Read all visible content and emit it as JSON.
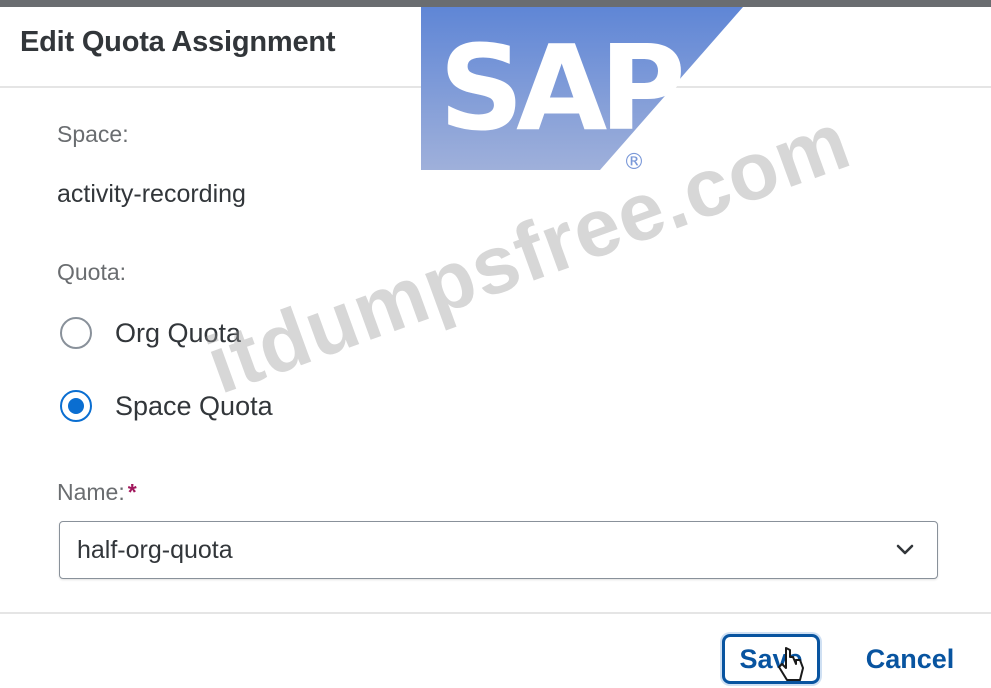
{
  "dialog": {
    "title": "Edit Quota Assignment"
  },
  "space": {
    "label": "Space:",
    "value": "activity-recording"
  },
  "quota": {
    "label": "Quota:",
    "options": [
      {
        "label": "Org Quota",
        "selected": false
      },
      {
        "label": "Space Quota",
        "selected": true
      }
    ]
  },
  "name_field": {
    "label": "Name:",
    "required_marker": "*",
    "value": "half-org-quota"
  },
  "footer": {
    "save_label": "Save",
    "cancel_label": "Cancel"
  },
  "overlays": {
    "logo_text": "SAP",
    "registered_mark": "®",
    "watermark_text": "itdumpsfree.com"
  },
  "colors": {
    "accent": "#0a6ed1",
    "button_text": "#0854a0",
    "required": "#a1175c",
    "logo_blue": "#6f8fd6"
  },
  "icons": [
    "chevron-down-icon",
    "radio-icon",
    "cursor-pointer-icon",
    "sap-logo"
  ]
}
